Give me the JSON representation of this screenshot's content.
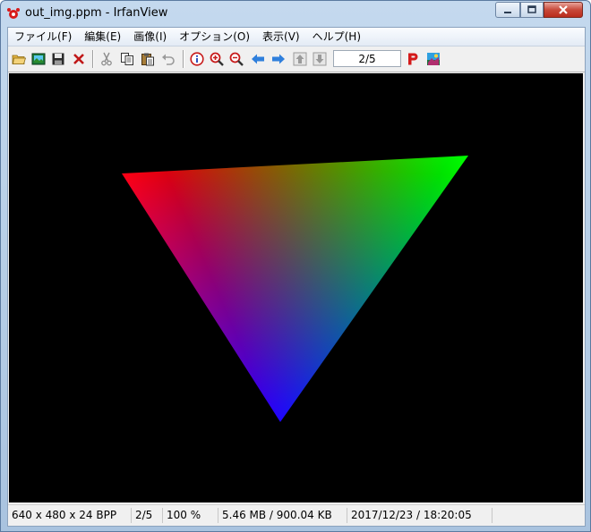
{
  "window": {
    "title": "out_img.ppm - IrfanView"
  },
  "menubar": {
    "items": [
      {
        "label": "ファイル",
        "accel": "(F)",
        "accel_key": "F"
      },
      {
        "label": "編集",
        "accel": "(E)",
        "accel_key": "E"
      },
      {
        "label": "画像",
        "accel": "(I)",
        "accel_key": "I"
      },
      {
        "label": "オプション",
        "accel": "(O)",
        "accel_key": "O"
      },
      {
        "label": "表示",
        "accel": "(V)",
        "accel_key": "V"
      },
      {
        "label": "ヘルプ",
        "accel": "(H)",
        "accel_key": "H"
      }
    ]
  },
  "toolbar": {
    "page_indicator": "2/5",
    "icons": [
      "open-folder-icon",
      "slideshow-icon",
      "save-icon",
      "delete-icon",
      "cut-icon",
      "copy-icon",
      "paste-icon",
      "undo-icon",
      "info-icon",
      "zoom-in-icon",
      "zoom-out-icon",
      "previous-icon",
      "next-icon",
      "page-up-icon",
      "page-down-icon",
      "print-icon",
      "about-icon"
    ]
  },
  "statusbar": {
    "dimensions": "640 x 480 x 24 BPP",
    "page": "2/5",
    "zoom": "100 %",
    "size": "5.46 MB / 900.04 KB",
    "datetime": "2017/12/23 / 18:20:05"
  },
  "colors": {
    "vertex_top_left": "#ff0000",
    "vertex_top_right": "#00ff00",
    "vertex_bottom": "#0000ff",
    "canvas_background": "#000000",
    "toolbar_blue": "#2f7fdc"
  }
}
